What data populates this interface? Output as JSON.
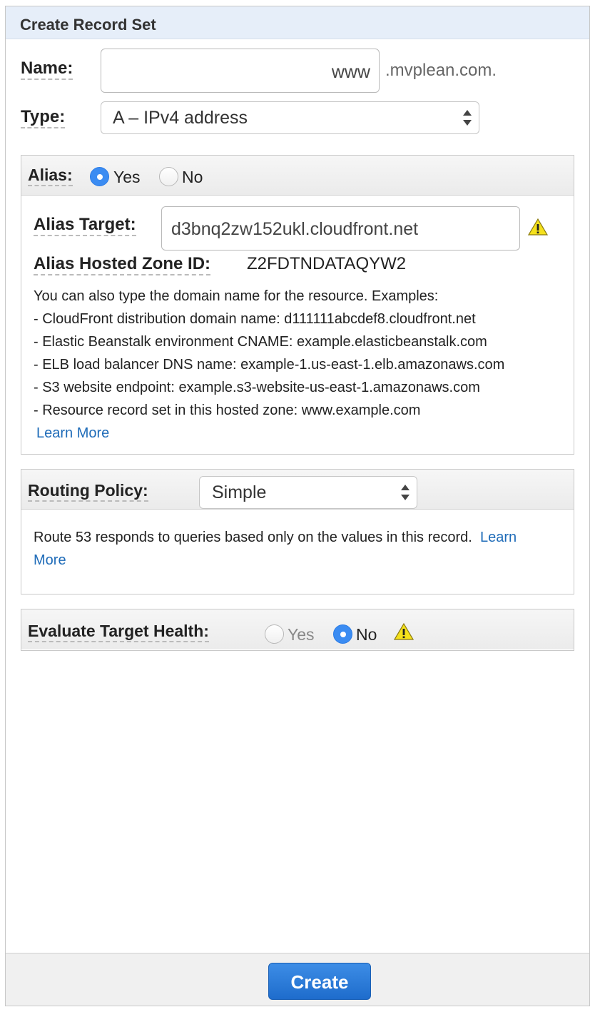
{
  "header": {
    "title": "Create Record Set"
  },
  "name": {
    "label": "Name:",
    "value": "www",
    "suffix": ".mvplean.com."
  },
  "type": {
    "label": "Type:",
    "selected": "A – IPv4 address"
  },
  "alias": {
    "label": "Alias:",
    "yes_label": "Yes",
    "no_label": "No",
    "selected": "Yes",
    "target_label": "Alias Target:",
    "target_value": "d3bnq2zw152ukl.cloudfront.net",
    "hosted_zone_label": "Alias Hosted Zone ID:",
    "hosted_zone_value": "Z2FDTNDATAQYW2",
    "help_intro": "You can also type the domain name for the resource. Examples:",
    "examples": [
      "-  CloudFront distribution domain name: d111111abcdef8.cloudfront.net",
      "-  Elastic Beanstalk environment CNAME: example.elasticbeanstalk.com",
      "-  ELB load balancer DNS name: example-1.us-east-1.elb.amazonaws.com",
      "-  S3 website endpoint: example.s3-website-us-east-1.amazonaws.com",
      "-  Resource record set in this hosted zone: www.example.com"
    ],
    "learn_more": "Learn More"
  },
  "routing": {
    "label": "Routing Policy:",
    "selected": "Simple",
    "description": "Route 53 responds to queries based only on the values in this record.",
    "learn_word": "Learn",
    "more_word": "More"
  },
  "health": {
    "label": "Evaluate Target Health:",
    "yes_label": "Yes",
    "no_label": "No",
    "selected": "No"
  },
  "footer": {
    "create_label": "Create"
  },
  "colors": {
    "accent": "#2b7ce6",
    "link": "#1e6bb8",
    "header_bg": "#e6eef9"
  },
  "icons": [
    "warning-icon",
    "select-arrows-icon"
  ]
}
